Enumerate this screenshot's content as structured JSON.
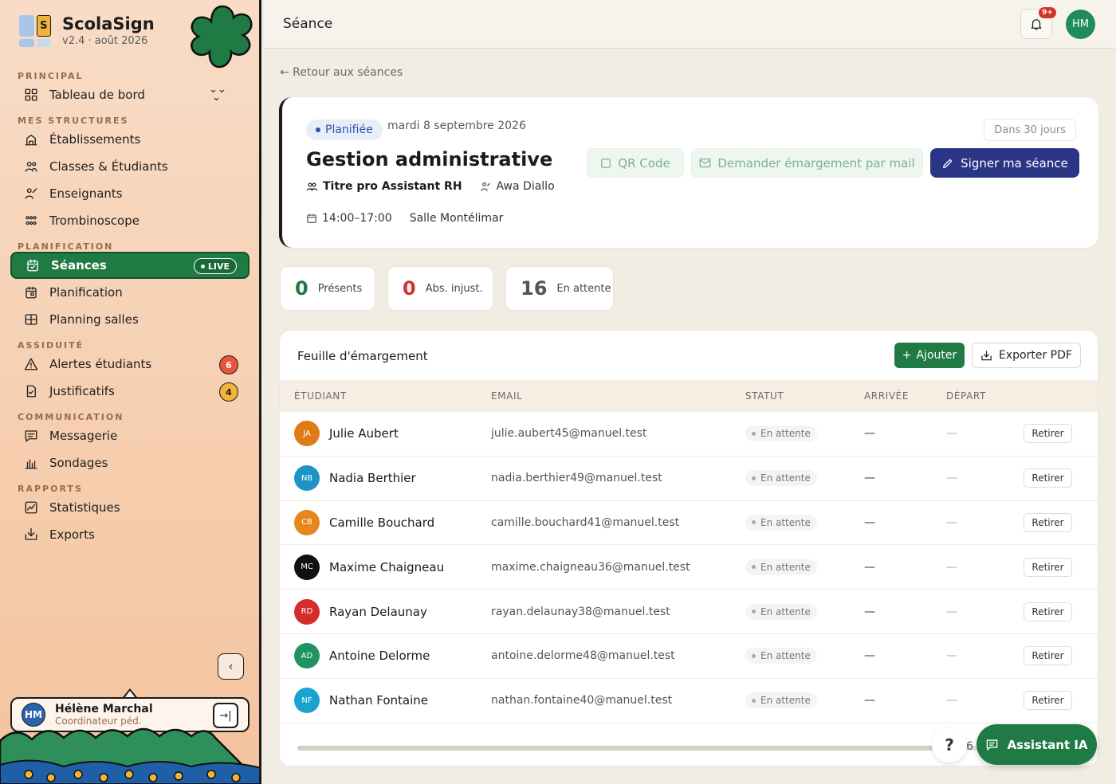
{
  "brand": {
    "name": "ScolaSign",
    "version": "v2.4 · août 2026",
    "logo_letter": "S"
  },
  "sidebar": {
    "sections": [
      {
        "label": "PRINCIPAL",
        "items": [
          {
            "label": "Tableau de bord",
            "icon": "dashboard-icon"
          }
        ]
      },
      {
        "label": "MES STRUCTURES",
        "items": [
          {
            "label": "Établissements",
            "icon": "building-icon"
          },
          {
            "label": "Classes & Étudiants",
            "icon": "users-icon"
          },
          {
            "label": "Enseignants",
            "icon": "teacher-icon"
          },
          {
            "label": "Trombinoscope",
            "icon": "grid-people-icon"
          }
        ]
      },
      {
        "label": "PLANIFICATION",
        "items": [
          {
            "label": "Séances",
            "icon": "calendar-check-icon",
            "active": true,
            "badge": "LIVE"
          },
          {
            "label": "Planification",
            "icon": "calendar-icon"
          },
          {
            "label": "Planning salles",
            "icon": "rooms-icon"
          }
        ]
      },
      {
        "label": "ASSIDUITÉ",
        "items": [
          {
            "label": "Alertes étudiants",
            "icon": "warning-icon",
            "count": "6"
          },
          {
            "label": "Justificatifs",
            "icon": "document-check-icon",
            "count": "4"
          }
        ]
      },
      {
        "label": "COMMUNICATION",
        "items": [
          {
            "label": "Messagerie",
            "icon": "message-icon"
          },
          {
            "label": "Sondages",
            "icon": "poll-icon"
          }
        ]
      },
      {
        "label": "RAPPORTS",
        "items": [
          {
            "label": "Statistiques",
            "icon": "stats-icon"
          },
          {
            "label": "Exports",
            "icon": "export-icon"
          }
        ]
      }
    ]
  },
  "user": {
    "initials": "HM",
    "name": "Hélène Marchal",
    "role": "Coordinateur péd."
  },
  "topbar": {
    "title": "Séance",
    "notif_badge": "9+",
    "avatar": "HM"
  },
  "back_link": "← Retour aux séances",
  "session": {
    "status": "Planifiée",
    "date": "mardi 8 septembre 2026",
    "countdown": "Dans 30 jours",
    "title": "Gestion administrative",
    "program": "Titre pro Assistant RH",
    "teacher": "Awa Diallo",
    "time": "14:00–17:00",
    "room": "Salle Montélimar",
    "btn_qr": "QR Code",
    "btn_mail": "Demander émargement par mail",
    "btn_sign": "Signer ma séance"
  },
  "stats": [
    {
      "value": "0",
      "label": "Présents",
      "color": "#1f7a43"
    },
    {
      "value": "0",
      "label": "Abs. injust.",
      "color": "#d2342a"
    },
    {
      "value": "16",
      "label": "En attente",
      "color": "#555555"
    }
  ],
  "sheet": {
    "title": "Feuille d'émargement",
    "btn_add": "Ajouter",
    "btn_pdf": "Exporter PDF",
    "columns": [
      "ÉTUDIANT",
      "EMAIL",
      "STATUT",
      "ARRIVÉE",
      "DÉPART"
    ],
    "rows": [
      {
        "initials": "JA",
        "color": "#e07a16",
        "name": "Julie Aubert",
        "email": "julie.aubert45@manuel.test",
        "status": "En attente",
        "arrival": "—",
        "departure": "—",
        "action": "Retirer"
      },
      {
        "initials": "NB",
        "color": "#1d94c4",
        "name": "Nadia Berthier",
        "email": "nadia.berthier49@manuel.test",
        "status": "En attente",
        "arrival": "—",
        "departure": "—",
        "action": "Retirer"
      },
      {
        "initials": "CB",
        "color": "#e6861c",
        "name": "Camille Bouchard",
        "email": "camille.bouchard41@manuel.test",
        "status": "En attente",
        "arrival": "—",
        "departure": "—",
        "action": "Retirer"
      },
      {
        "initials": "MC",
        "color": "#111111",
        "name": "Maxime Chaigneau",
        "email": "maxime.chaigneau36@manuel.test",
        "status": "En attente",
        "arrival": "—",
        "departure": "—",
        "action": "Retirer"
      },
      {
        "initials": "RD",
        "color": "#d62b2b",
        "name": "Rayan Delaunay",
        "email": "rayan.delaunay38@manuel.test",
        "status": "En attente",
        "arrival": "—",
        "departure": "—",
        "action": "Retirer"
      },
      {
        "initials": "AD",
        "color": "#1f9460",
        "name": "Antoine Delorme",
        "email": "antoine.delorme48@manuel.test",
        "status": "En attente",
        "arrival": "—",
        "departure": "—",
        "action": "Retirer"
      },
      {
        "initials": "NF",
        "color": "#1aa3cf",
        "name": "Nathan Fontaine",
        "email": "nathan.fontaine40@manuel.test",
        "status": "En attente",
        "arrival": "—",
        "departure": "—",
        "action": "Retirer"
      }
    ]
  },
  "floating": {
    "help": "?",
    "peek": "6",
    "assistant": "Assistant IA"
  }
}
